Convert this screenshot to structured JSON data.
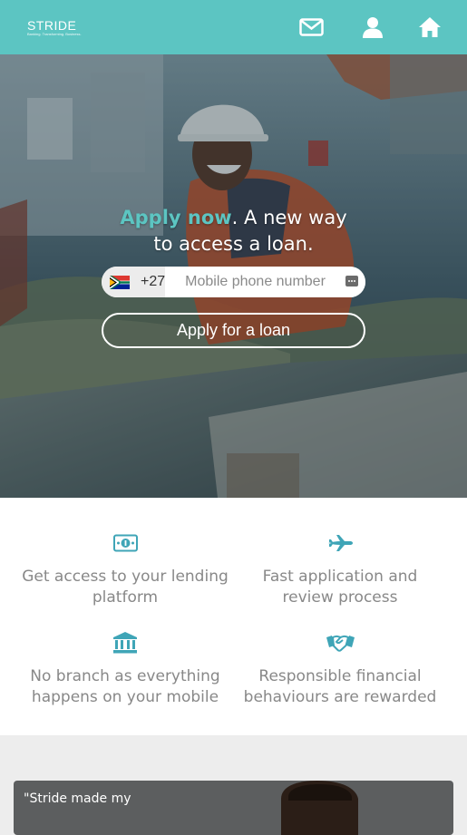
{
  "header": {
    "logo_text": "STRIDE",
    "logo_tagline": "Banking. Transforming. Business.",
    "icons": [
      "mail-icon",
      "user-icon",
      "home-icon"
    ],
    "background_color": "#5cc5c2"
  },
  "hero": {
    "headline_accent": "Apply now",
    "headline_rest": ". A new way",
    "headline_line2": "to access a loan.",
    "country_code": "+27",
    "country_flag": "south-africa-flag-icon",
    "phone_placeholder": "Mobile phone number",
    "apply_button": "Apply for a loan"
  },
  "features": [
    {
      "icon": "money-icon",
      "text": "Get access to your lending platform"
    },
    {
      "icon": "airplane-icon",
      "text": "Fast application and review process"
    },
    {
      "icon": "bank-icon",
      "text": "No branch as everything happens on your mobile"
    },
    {
      "icon": "handshake-icon",
      "text": "Responsible financial behaviours are rewarded"
    }
  ],
  "testimonial": {
    "quote_start": "\"Stride made my"
  },
  "colors": {
    "accent": "#5cc5c2",
    "feature_text": "#888888",
    "page_background": "#ededed"
  }
}
